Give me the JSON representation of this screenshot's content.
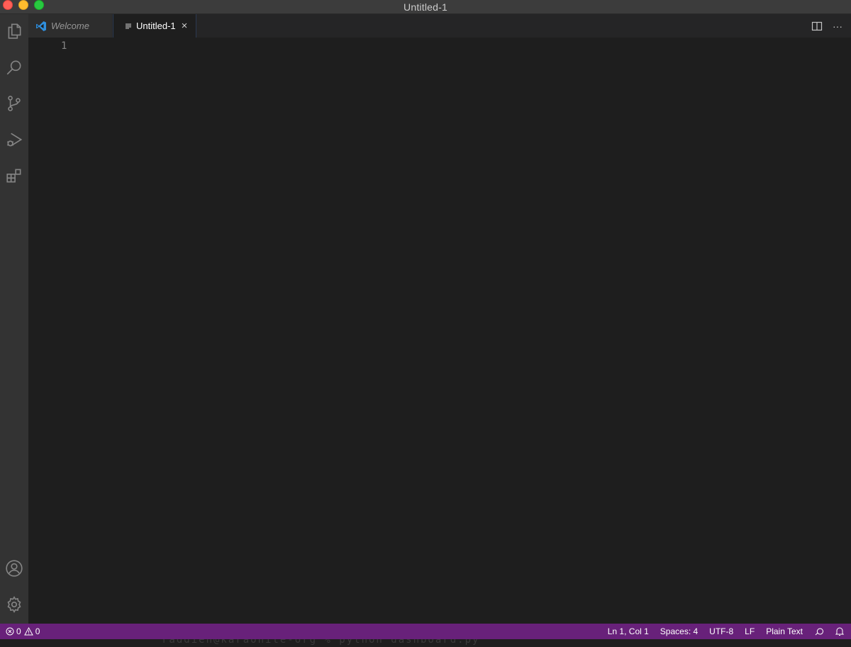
{
  "window": {
    "title": "Untitled-1"
  },
  "activity_bar": {
    "top_icons": [
      "explorer-icon",
      "search-icon",
      "source-control-icon",
      "run-debug-icon",
      "extensions-icon"
    ],
    "bottom_icons": [
      "accounts-icon",
      "settings-gear-icon"
    ]
  },
  "tabs": [
    {
      "label": "Welcome",
      "icon": "vscode-logo-icon",
      "active": false
    },
    {
      "label": "Untitled-1",
      "icon": "text-file-icon",
      "active": true,
      "close": "×"
    }
  ],
  "editor_actions": {
    "split": "split-editor-icon",
    "more": "···"
  },
  "editor": {
    "line_numbers": [
      "1"
    ]
  },
  "status_bar": {
    "errors": "0",
    "warnings": "0",
    "position": "Ln 1, Col 1",
    "indentation": "Spaces: 4",
    "encoding": "UTF-8",
    "eol": "LF",
    "language": "Plain Text"
  },
  "terminal_ghost": {
    "text": "raddien@karaonite-org % python dashboard.py"
  },
  "colors": {
    "status_bar": "#68217a",
    "activity_bar": "#333333",
    "editor_bg": "#1e1e1e",
    "tab_bar": "#252526",
    "vscode_blue": "#2f8fde"
  }
}
